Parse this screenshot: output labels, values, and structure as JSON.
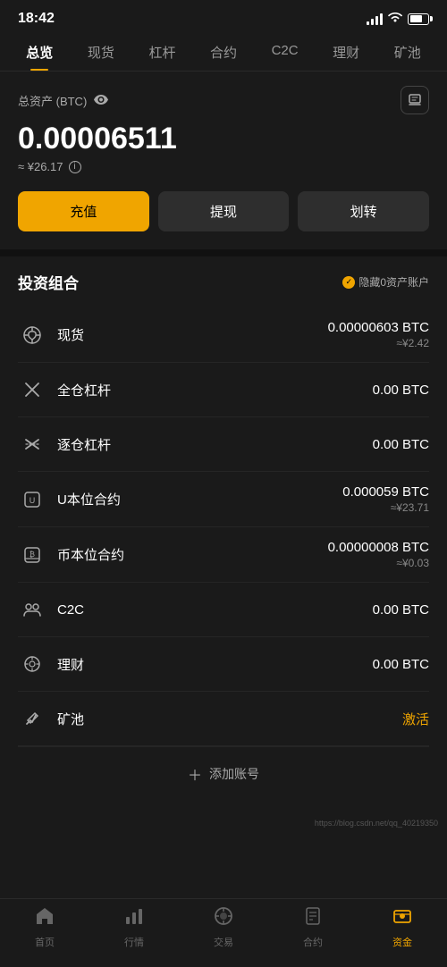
{
  "statusBar": {
    "time": "18:42"
  },
  "navTabs": {
    "items": [
      "总览",
      "现货",
      "杠杆",
      "合约",
      "C2C",
      "理财",
      "矿池"
    ],
    "activeIndex": 0
  },
  "assetSection": {
    "label": "总资产 (BTC)",
    "amount": "0.00006511",
    "fiatApprox": "≈ ¥26.17",
    "eyeLabel": "👁",
    "historyLabel": "⊙"
  },
  "actionButtons": {
    "deposit": "充值",
    "withdraw": "提现",
    "transfer": "划转"
  },
  "portfolio": {
    "title": "投资组合",
    "hideAssets": "隐藏0资产账户",
    "items": [
      {
        "icon": "⟳",
        "name": "现货",
        "btc": "0.00000603 BTC",
        "cny": "≈¥2.42",
        "activate": false
      },
      {
        "icon": "✕",
        "name": "全仓杠杆",
        "btc": "0.00 BTC",
        "cny": "",
        "activate": false
      },
      {
        "icon": "⊘",
        "name": "逐仓杠杆",
        "btc": "0.00 BTC",
        "cny": "",
        "activate": false
      },
      {
        "icon": "⊡",
        "name": "U本位合约",
        "btc": "0.000059 BTC",
        "cny": "≈¥23.71",
        "activate": false
      },
      {
        "icon": "⊟",
        "name": "币本位合约",
        "btc": "0.00000008 BTC",
        "cny": "≈¥0.03",
        "activate": false
      },
      {
        "icon": "⊞",
        "name": "C2C",
        "btc": "0.00 BTC",
        "cny": "",
        "activate": false
      },
      {
        "icon": "◎",
        "name": "理财",
        "btc": "0.00 BTC",
        "cny": "",
        "activate": false
      },
      {
        "icon": "⛏",
        "name": "矿池",
        "btc": "",
        "cny": "",
        "activate": true,
        "activateLabel": "激活"
      }
    ],
    "addAccount": "+ 添加账号"
  },
  "bottomNav": {
    "items": [
      {
        "label": "首页",
        "icon": "🏠",
        "active": false
      },
      {
        "label": "行情",
        "icon": "📊",
        "active": false
      },
      {
        "label": "交易",
        "icon": "💿",
        "active": false
      },
      {
        "label": "合约",
        "icon": "📋",
        "active": false
      },
      {
        "label": "资金",
        "icon": "💼",
        "active": true
      }
    ]
  },
  "watermark": "https://blog.csdn.net/qq_40219350"
}
